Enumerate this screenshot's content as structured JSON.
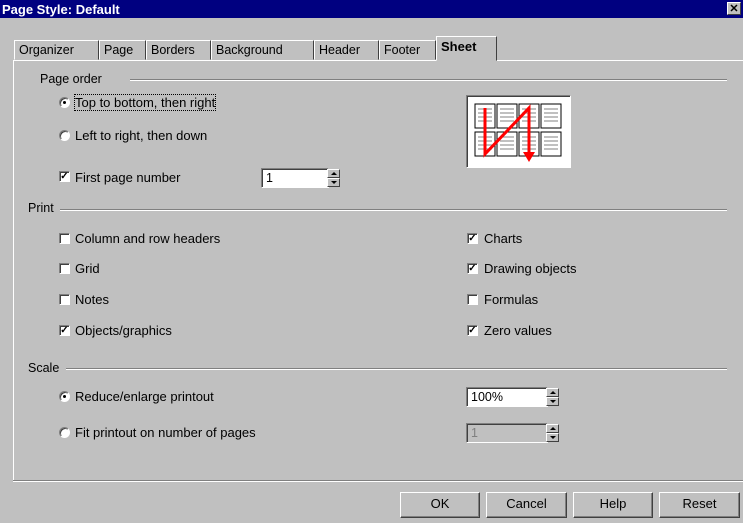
{
  "window": {
    "title": "Page Style: Default",
    "close_glyph": "✕"
  },
  "tabs": [
    "Organizer",
    "Page",
    "Borders",
    "Background",
    "Header",
    "Footer",
    "Sheet"
  ],
  "active_tab": "Sheet",
  "page_order": {
    "label": "Page order",
    "options": [
      "Top to bottom, then right",
      "Left to right, then down"
    ],
    "selected": "Top to bottom, then right",
    "first_page_number": {
      "label": "First page number",
      "checked": true,
      "value": "1"
    }
  },
  "print": {
    "label": "Print",
    "items": [
      {
        "label": "Column and row headers",
        "checked": false
      },
      {
        "label": "Grid",
        "checked": false
      },
      {
        "label": "Notes",
        "checked": false
      },
      {
        "label": "Objects/graphics",
        "checked": true
      },
      {
        "label": "Charts",
        "checked": true
      },
      {
        "label": "Drawing objects",
        "checked": true
      },
      {
        "label": "Formulas",
        "checked": false
      },
      {
        "label": "Zero values",
        "checked": true
      }
    ]
  },
  "scale": {
    "label": "Scale",
    "options": [
      "Reduce/enlarge printout",
      "Fit printout on number of pages"
    ],
    "selected": "Reduce/enlarge printout",
    "reduce_value": "100%",
    "pages_value": "1"
  },
  "buttons": {
    "ok": "OK",
    "cancel": "Cancel",
    "help": "Help",
    "reset": "Reset"
  },
  "colors": {
    "titlebar": "#000080",
    "preview_arrow": "#ff0000"
  }
}
